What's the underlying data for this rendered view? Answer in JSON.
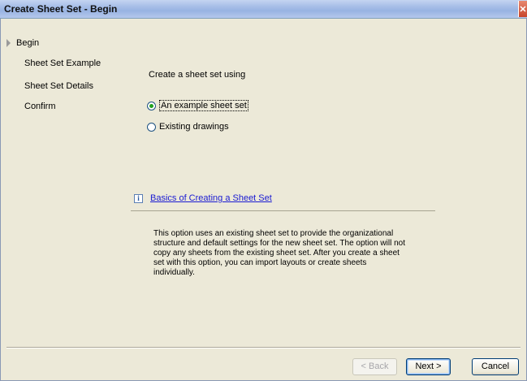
{
  "window": {
    "title": "Create Sheet Set - Begin",
    "close_symbol": "✕"
  },
  "nav": {
    "items": [
      {
        "label": "Begin",
        "current": true
      },
      {
        "label": "Sheet Set Example",
        "current": false
      },
      {
        "label": "Sheet Set Details",
        "current": false
      },
      {
        "label": "Confirm",
        "current": false
      }
    ]
  },
  "main": {
    "prompt": "Create a sheet set using",
    "options": [
      {
        "label": "An example sheet set",
        "checked": true
      },
      {
        "label": "Existing drawings",
        "checked": false
      }
    ],
    "info_link": "Basics of Creating a Sheet Set",
    "description": "This option uses an existing sheet set to provide the organizational structure and default settings for the new sheet set.  The option will not copy any sheets from the existing sheet set.  After you create a sheet set with this option, you can import layouts or create sheets individually."
  },
  "buttons": {
    "back": "< Back",
    "next": "Next >",
    "cancel": "Cancel"
  },
  "colors": {
    "link": "#1a1ad2",
    "radio_dot": "#21a121",
    "face": "#ece9d8"
  }
}
